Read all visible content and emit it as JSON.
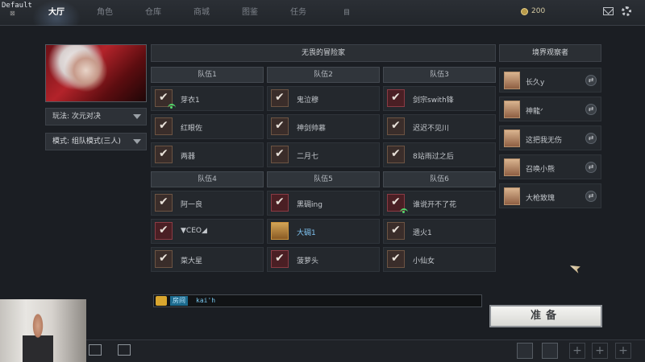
{
  "header": {
    "default_tag": "Default",
    "default_sub": "⊠",
    "nav": [
      "大厅",
      "角色",
      "仓库",
      "商城",
      "图鉴",
      "任务",
      "目"
    ],
    "coins": "200"
  },
  "left": {
    "mode_play": "玩法: 次元对决",
    "mode_team": "模式: 组队模式(三人)"
  },
  "room": {
    "title": "无畏的冒险家",
    "teams": [
      {
        "name": "队伍1",
        "members": [
          "芽衣1",
          "红眼佐",
          "两器"
        ]
      },
      {
        "name": "队伍2",
        "members": [
          "鬼泣穆",
          "神剑帅慕",
          "二月七"
        ]
      },
      {
        "name": "队伍3",
        "members": [
          "剑宗swith锋",
          "迟迟不见川",
          "8站雨过之后"
        ]
      },
      {
        "name": "队伍4",
        "members": [
          "阿一良",
          "▼CEO◢",
          "菜大星"
        ]
      },
      {
        "name": "队伍5",
        "members": [
          "黑碉ing",
          "大碉1",
          "菠萝头"
        ]
      },
      {
        "name": "队伍6",
        "members": [
          "谁说开不了花",
          "遗火1",
          "小仙女"
        ]
      }
    ]
  },
  "observers": {
    "title": "境界观察者",
    "list": [
      "长久y",
      "神龍ᐟ",
      "这把我无伤",
      "召唤小熊",
      "大枪致瑰"
    ]
  },
  "chat": {
    "channel": "房间",
    "text": "kai'h"
  },
  "ready_label": "准备",
  "colors": {
    "accent_blue": "#7fc4f2",
    "ready_bg": "#f4f4f2",
    "online_green": "#52d86d"
  }
}
